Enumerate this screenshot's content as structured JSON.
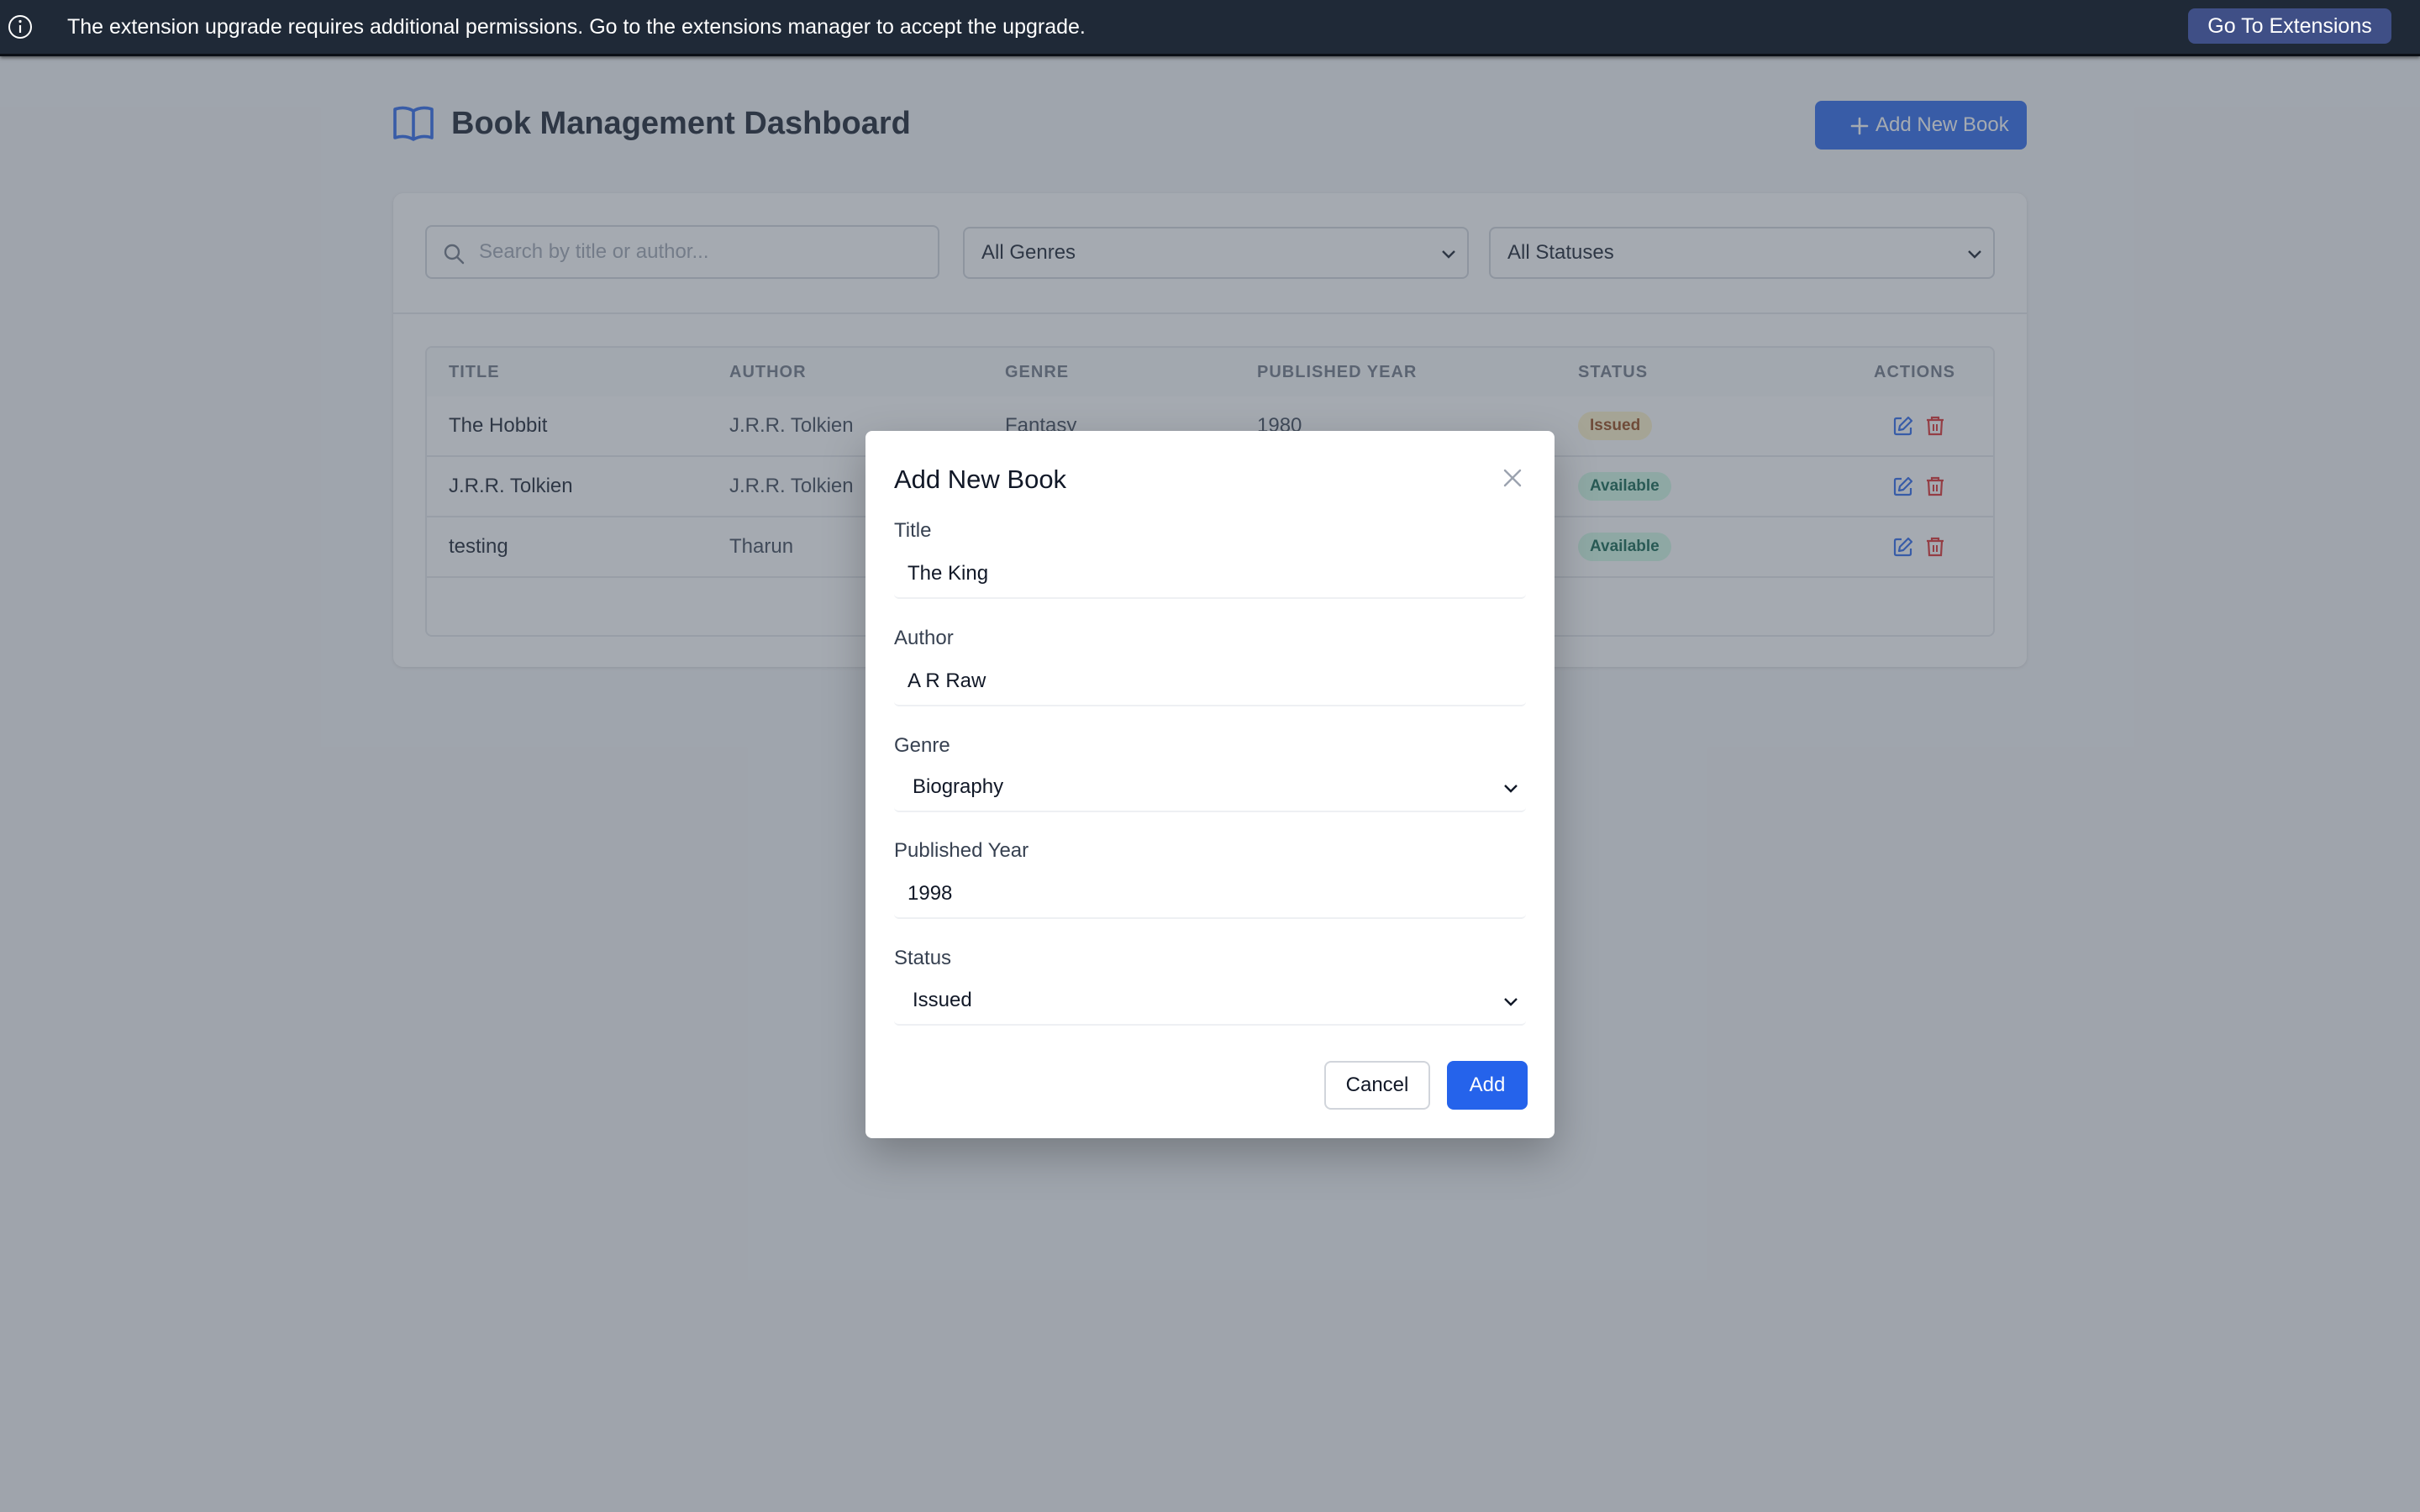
{
  "notification": {
    "message": "The extension upgrade requires additional permissions. Go to the extensions manager to accept the upgrade.",
    "action_label": "Go To Extensions"
  },
  "header": {
    "title": "Book Management Dashboard",
    "add_button_label": "Add New Book"
  },
  "filters": {
    "search_placeholder": "Search by title or author...",
    "genre_selected": "All Genres",
    "status_selected": "All Statuses"
  },
  "table": {
    "columns": [
      "TITLE",
      "AUTHOR",
      "GENRE",
      "PUBLISHED YEAR",
      "STATUS",
      "ACTIONS"
    ],
    "rows": [
      {
        "title": "The Hobbit",
        "author": "J.R.R. Tolkien",
        "genre": "Fantasy",
        "year": "1980",
        "status": "Issued"
      },
      {
        "title": "J.R.R. Tolkien",
        "author": "J.R.R. Tolkien",
        "genre": "",
        "year": "",
        "status": "Available"
      },
      {
        "title": "testing",
        "author": "Tharun",
        "genre": "",
        "year": "",
        "status": "Available"
      }
    ]
  },
  "modal": {
    "title": "Add New Book",
    "fields": {
      "title_label": "Title",
      "title_value": "The King",
      "author_label": "Author",
      "author_value": "A R Raw",
      "genre_label": "Genre",
      "genre_value": "Biography",
      "year_label": "Published Year",
      "year_value": "1998",
      "status_label": "Status",
      "status_value": "Issued"
    },
    "cancel_label": "Cancel",
    "submit_label": "Add"
  },
  "colors": {
    "primary": "#2563eb",
    "notice_bg": "#1f2937",
    "issued_badge": "#fef3c7",
    "available_badge": "#d1fae5",
    "delete_icon": "#dc2626"
  },
  "icons": {
    "notice": "info-icon",
    "logo": "open-book-icon",
    "add": "plus-icon",
    "search": "search-icon",
    "dropdown": "chevron-down-icon",
    "edit": "edit-icon",
    "delete": "trash-icon",
    "close": "close-icon"
  }
}
